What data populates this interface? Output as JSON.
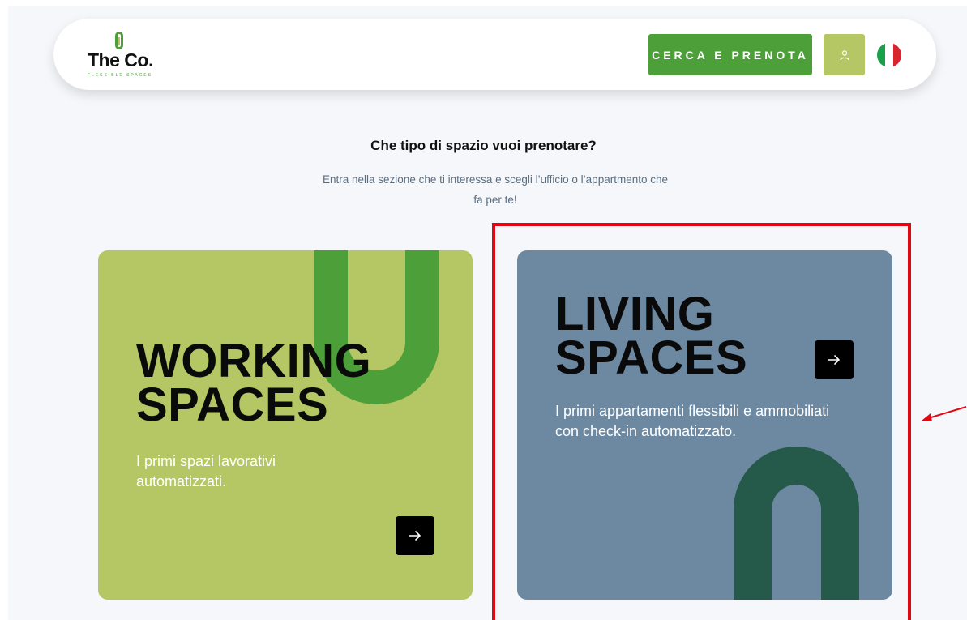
{
  "navbar": {
    "logo_text": "The Co.",
    "logo_sub": "FLESSIBLE SPACES",
    "cta_label": "CERCA E PRENOTA",
    "user_icon": "user-icon",
    "flag_icon": "italy-flag-icon"
  },
  "main": {
    "heading": "Che tipo di spazio vuoi prenotare?",
    "subheading": "Entra nella sezione che ti interessa e scegli l’ufficio o l’appartmento che fa per te!"
  },
  "cards": {
    "working": {
      "title_line1": "WORKING",
      "title_line2": "SPACES",
      "description": "I primi spazi lavorativi automatizzati.",
      "arrow_icon": "arrow-right-icon"
    },
    "living": {
      "title_line1": "LIVING",
      "title_line2": "SPACES",
      "description": "I primi appartamenti flessibili e ammobiliati con check-in automatizzato.",
      "arrow_icon": "arrow-right-icon"
    }
  },
  "colors": {
    "primary_green": "#4d9f3a",
    "light_green": "#b5c764",
    "slate_blue": "#6c89a1",
    "dark_green": "#255a4a",
    "highlight_red": "#e30613"
  }
}
